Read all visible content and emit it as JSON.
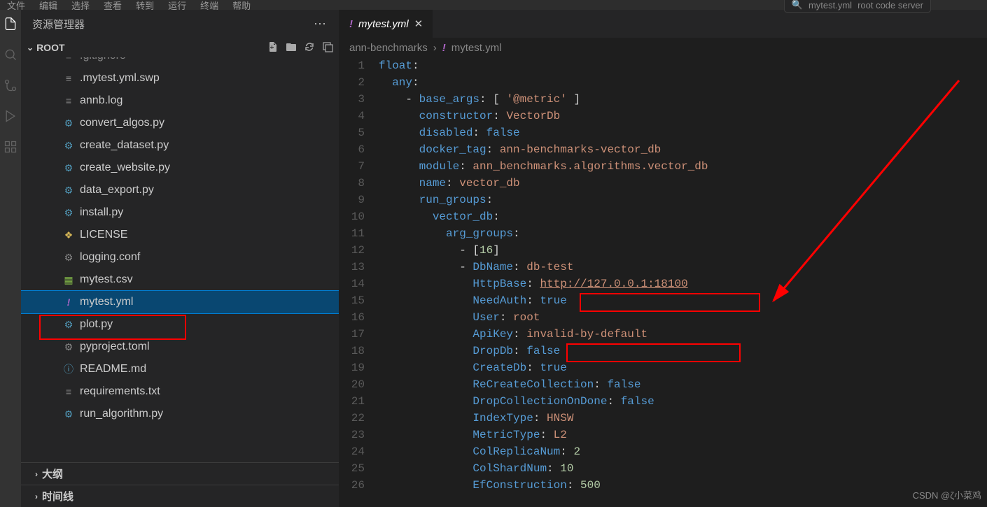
{
  "menubar": [
    "文件",
    "编辑",
    "选择",
    "查看",
    "转到",
    "运行",
    "终端",
    "帮助"
  ],
  "search_hint": "mytest.yml",
  "search_extra": "root   code server",
  "sidebar": {
    "title": "资源管理器",
    "root_label": "ROOT",
    "files": [
      {
        "icon": "txt",
        "name": ".gitignore"
      },
      {
        "icon": "txt",
        "name": ".mytest.yml.swp"
      },
      {
        "icon": "txt",
        "name": "annb.log"
      },
      {
        "icon": "py",
        "name": "convert_algos.py"
      },
      {
        "icon": "py",
        "name": "create_dataset.py"
      },
      {
        "icon": "py",
        "name": "create_website.py"
      },
      {
        "icon": "py",
        "name": "data_export.py"
      },
      {
        "icon": "py",
        "name": "install.py"
      },
      {
        "icon": "lic",
        "name": "LICENSE"
      },
      {
        "icon": "conf",
        "name": "logging.conf"
      },
      {
        "icon": "csv",
        "name": "mytest.csv"
      },
      {
        "icon": "yml",
        "name": "mytest.yml",
        "selected": true
      },
      {
        "icon": "py",
        "name": "plot.py"
      },
      {
        "icon": "conf",
        "name": "pyproject.toml"
      },
      {
        "icon": "md",
        "name": "README.md"
      },
      {
        "icon": "txt",
        "name": "requirements.txt"
      },
      {
        "icon": "py",
        "name": "run_algorithm.py"
      }
    ],
    "outline": "大纲",
    "timeline": "时间线"
  },
  "tab": {
    "name": "mytest.yml"
  },
  "breadcrumb": {
    "folder": "ann-benchmarks",
    "file": "mytest.yml"
  },
  "code": {
    "lines": [
      [
        {
          "t": "key",
          "v": "float"
        },
        {
          "t": "pun",
          "v": ":"
        }
      ],
      [
        {
          "t": "ind",
          "v": "  "
        },
        {
          "t": "key",
          "v": "any"
        },
        {
          "t": "pun",
          "v": ":"
        }
      ],
      [
        {
          "t": "ind",
          "v": "    "
        },
        {
          "t": "pun",
          "v": "- "
        },
        {
          "t": "key",
          "v": "base_args"
        },
        {
          "t": "pun",
          "v": ": [ "
        },
        {
          "t": "str",
          "v": "'@metric'"
        },
        {
          "t": "pun",
          "v": " ]"
        }
      ],
      [
        {
          "t": "ind",
          "v": "      "
        },
        {
          "t": "key",
          "v": "constructor"
        },
        {
          "t": "pun",
          "v": ": "
        },
        {
          "t": "str",
          "v": "VectorDb"
        }
      ],
      [
        {
          "t": "ind",
          "v": "      "
        },
        {
          "t": "key",
          "v": "disabled"
        },
        {
          "t": "pun",
          "v": ": "
        },
        {
          "t": "bool",
          "v": "false"
        }
      ],
      [
        {
          "t": "ind",
          "v": "      "
        },
        {
          "t": "key",
          "v": "docker_tag"
        },
        {
          "t": "pun",
          "v": ": "
        },
        {
          "t": "str",
          "v": "ann-benchmarks-vector_db"
        }
      ],
      [
        {
          "t": "ind",
          "v": "      "
        },
        {
          "t": "key",
          "v": "module"
        },
        {
          "t": "pun",
          "v": ": "
        },
        {
          "t": "str",
          "v": "ann_benchmarks.algorithms.vector_db"
        }
      ],
      [
        {
          "t": "ind",
          "v": "      "
        },
        {
          "t": "key",
          "v": "name"
        },
        {
          "t": "pun",
          "v": ": "
        },
        {
          "t": "str",
          "v": "vector_db"
        }
      ],
      [
        {
          "t": "ind",
          "v": "      "
        },
        {
          "t": "key",
          "v": "run_groups"
        },
        {
          "t": "pun",
          "v": ":"
        }
      ],
      [
        {
          "t": "ind",
          "v": "        "
        },
        {
          "t": "key",
          "v": "vector_db"
        },
        {
          "t": "pun",
          "v": ":"
        }
      ],
      [
        {
          "t": "ind",
          "v": "          "
        },
        {
          "t": "key",
          "v": "arg_groups"
        },
        {
          "t": "pun",
          "v": ":"
        }
      ],
      [
        {
          "t": "ind",
          "v": "            "
        },
        {
          "t": "pun",
          "v": "- ["
        },
        {
          "t": "num",
          "v": "16"
        },
        {
          "t": "pun",
          "v": "]"
        }
      ],
      [
        {
          "t": "ind",
          "v": "            "
        },
        {
          "t": "pun",
          "v": "- "
        },
        {
          "t": "key",
          "v": "DbName"
        },
        {
          "t": "pun",
          "v": ": "
        },
        {
          "t": "str",
          "v": "db-test"
        }
      ],
      [
        {
          "t": "ind",
          "v": "              "
        },
        {
          "t": "key",
          "v": "HttpBase"
        },
        {
          "t": "pun",
          "v": ": "
        },
        {
          "t": "link",
          "v": "http://127.0.0.1:18100"
        }
      ],
      [
        {
          "t": "ind",
          "v": "              "
        },
        {
          "t": "key",
          "v": "NeedAuth"
        },
        {
          "t": "pun",
          "v": ": "
        },
        {
          "t": "bool",
          "v": "true"
        }
      ],
      [
        {
          "t": "ind",
          "v": "              "
        },
        {
          "t": "key",
          "v": "User"
        },
        {
          "t": "pun",
          "v": ": "
        },
        {
          "t": "str",
          "v": "root"
        }
      ],
      [
        {
          "t": "ind",
          "v": "              "
        },
        {
          "t": "key",
          "v": "ApiKey"
        },
        {
          "t": "pun",
          "v": ": "
        },
        {
          "t": "str",
          "v": "invalid-by-default"
        }
      ],
      [
        {
          "t": "ind",
          "v": "              "
        },
        {
          "t": "key",
          "v": "DropDb"
        },
        {
          "t": "pun",
          "v": ": "
        },
        {
          "t": "bool",
          "v": "false"
        }
      ],
      [
        {
          "t": "ind",
          "v": "              "
        },
        {
          "t": "key",
          "v": "CreateDb"
        },
        {
          "t": "pun",
          "v": ": "
        },
        {
          "t": "bool",
          "v": "true"
        }
      ],
      [
        {
          "t": "ind",
          "v": "              "
        },
        {
          "t": "key",
          "v": "ReCreateCollection"
        },
        {
          "t": "pun",
          "v": ": "
        },
        {
          "t": "bool",
          "v": "false"
        }
      ],
      [
        {
          "t": "ind",
          "v": "              "
        },
        {
          "t": "key",
          "v": "DropCollectionOnDone"
        },
        {
          "t": "pun",
          "v": ": "
        },
        {
          "t": "bool",
          "v": "false"
        }
      ],
      [
        {
          "t": "ind",
          "v": "              "
        },
        {
          "t": "key",
          "v": "IndexType"
        },
        {
          "t": "pun",
          "v": ": "
        },
        {
          "t": "str",
          "v": "HNSW"
        }
      ],
      [
        {
          "t": "ind",
          "v": "              "
        },
        {
          "t": "key",
          "v": "MetricType"
        },
        {
          "t": "pun",
          "v": ": "
        },
        {
          "t": "str",
          "v": "L2"
        }
      ],
      [
        {
          "t": "ind",
          "v": "              "
        },
        {
          "t": "key",
          "v": "ColReplicaNum"
        },
        {
          "t": "pun",
          "v": ": "
        },
        {
          "t": "num",
          "v": "2"
        }
      ],
      [
        {
          "t": "ind",
          "v": "              "
        },
        {
          "t": "key",
          "v": "ColShardNum"
        },
        {
          "t": "pun",
          "v": ": "
        },
        {
          "t": "num",
          "v": "10"
        }
      ],
      [
        {
          "t": "ind",
          "v": "              "
        },
        {
          "t": "key",
          "v": "EfConstruction"
        },
        {
          "t": "pun",
          "v": ": "
        },
        {
          "t": "num",
          "v": "500"
        }
      ]
    ]
  },
  "watermark": "CSDN @ζ小菜鸡"
}
